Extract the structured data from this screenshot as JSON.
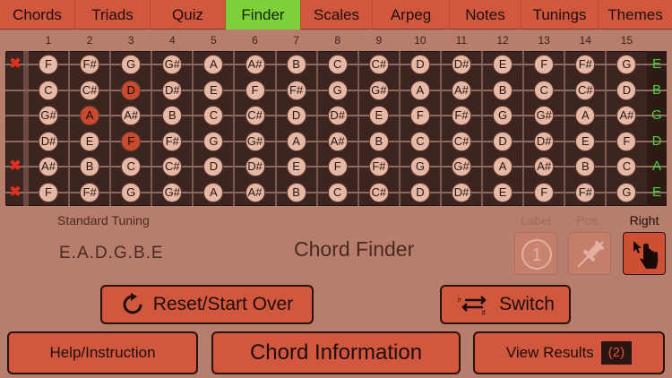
{
  "tabs": [
    {
      "label": "Chords",
      "active": false
    },
    {
      "label": "Triads",
      "active": false
    },
    {
      "label": "Quiz",
      "active": false
    },
    {
      "label": "Finder",
      "active": true
    },
    {
      "label": "Scales",
      "active": false
    },
    {
      "label": "Arpeg",
      "active": false
    },
    {
      "label": "Notes",
      "active": false
    },
    {
      "label": "Tunings",
      "active": false
    },
    {
      "label": "Themes",
      "active": false
    }
  ],
  "frets": [
    "1",
    "2",
    "3",
    "4",
    "5",
    "6",
    "7",
    "8",
    "9",
    "10",
    "11",
    "12",
    "13",
    "14",
    "15"
  ],
  "strings": [
    {
      "open": "E",
      "muted": true,
      "notes": [
        "F",
        "F#",
        "G",
        "G#",
        "A",
        "A#",
        "B",
        "C",
        "C#",
        "D",
        "D#",
        "E",
        "F",
        "F#",
        "G"
      ]
    },
    {
      "open": "B",
      "muted": false,
      "notes": [
        "C",
        "C#",
        "D",
        "D#",
        "E",
        "F",
        "F#",
        "G",
        "G#",
        "A",
        "A#",
        "B",
        "C",
        "C#",
        "D"
      ]
    },
    {
      "open": "G",
      "muted": false,
      "notes": [
        "G#",
        "A",
        "A#",
        "B",
        "C",
        "C#",
        "D",
        "D#",
        "E",
        "F",
        "F#",
        "G",
        "G#",
        "A",
        "A#"
      ]
    },
    {
      "open": "D",
      "muted": false,
      "notes": [
        "D#",
        "E",
        "F",
        "F#",
        "G",
        "G#",
        "A",
        "A#",
        "B",
        "C",
        "C#",
        "D",
        "D#",
        "E",
        "F"
      ]
    },
    {
      "open": "A",
      "muted": true,
      "notes": [
        "A#",
        "B",
        "C",
        "C#",
        "D",
        "D#",
        "E",
        "F",
        "F#",
        "G",
        "G#",
        "A",
        "A#",
        "B",
        "C"
      ]
    },
    {
      "open": "E",
      "muted": true,
      "notes": [
        "F",
        "F#",
        "G",
        "G#",
        "A",
        "A#",
        "B",
        "C",
        "C#",
        "D",
        "D#",
        "E",
        "F",
        "F#",
        "G"
      ]
    }
  ],
  "selected_notes": [
    {
      "string": 1,
      "fret": 3,
      "note": "D"
    },
    {
      "string": 2,
      "fret": 2,
      "note": "A"
    },
    {
      "string": 3,
      "fret": 3,
      "note": "F"
    }
  ],
  "tuning": {
    "label": "Standard Tuning",
    "value": "E.A.D.G.B.E"
  },
  "mode_title": "Chord Finder",
  "options": [
    {
      "label": "Label",
      "active": false,
      "icon": "number-one-icon"
    },
    {
      "label": "Pos.",
      "active": false,
      "icon": "pin-icon"
    },
    {
      "label": "Right",
      "active": true,
      "icon": "right-hand-icon"
    }
  ],
  "buttons": {
    "reset": "Reset/Start Over",
    "switch": "Switch",
    "help": "Help/Instruction",
    "chord_info": "Chord Information",
    "view_results": "View Results",
    "results_count": "(2)"
  },
  "colors": {
    "background": "#b77e6d",
    "tab_bar": "#d1583f",
    "active_tab": "#7dd03a",
    "fretboard": "#3c2520",
    "note_dot": "#e6b8a6",
    "selected_dot": "#c84a2f",
    "open_string_text": "#4ad63a",
    "mute_mark": "#e03020"
  }
}
